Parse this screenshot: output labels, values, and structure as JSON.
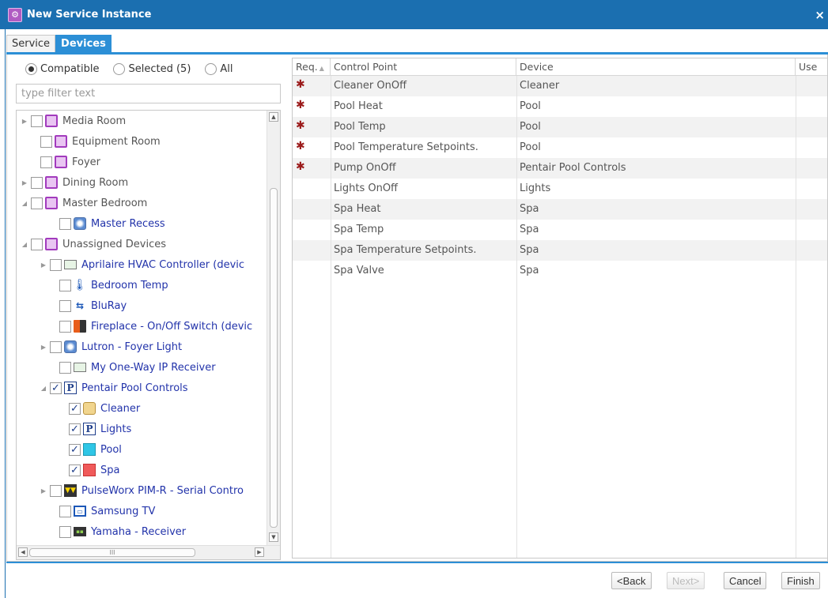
{
  "window": {
    "title": "New Service Instance",
    "close_glyph": "×",
    "icon": "gear-app-icon"
  },
  "tabs": [
    {
      "label": "Service",
      "active": false
    },
    {
      "label": "Devices",
      "active": true
    }
  ],
  "filter": {
    "options": [
      {
        "label": "Compatible",
        "selected": true
      },
      {
        "label": "Selected (5)",
        "selected": false
      },
      {
        "label": "All",
        "selected": false
      }
    ],
    "placeholder": "type filter text"
  },
  "tree": [
    {
      "label": "Media Room",
      "icon": "room-icon",
      "toggle": "collapsed",
      "checked": false,
      "kind": "room"
    },
    {
      "label": "Equipment Room",
      "icon": "room-icon",
      "toggle": "",
      "checked": false,
      "kind": "room"
    },
    {
      "label": "Foyer",
      "icon": "room-icon",
      "toggle": "",
      "checked": false,
      "kind": "room"
    },
    {
      "label": "Dining Room",
      "icon": "room-icon",
      "toggle": "collapsed",
      "checked": false,
      "kind": "room"
    },
    {
      "label": "Master Bedroom",
      "icon": "room-icon",
      "toggle": "expanded",
      "checked": false,
      "kind": "room"
    },
    {
      "label": "Master Recess",
      "icon": "light-icon",
      "toggle": "",
      "checked": false,
      "kind": "device"
    },
    {
      "label": "Unassigned Devices",
      "icon": "room-icon",
      "toggle": "expanded",
      "checked": false,
      "kind": "room"
    },
    {
      "label": "Aprilaire HVAC Controller (devic",
      "icon": "hvac-icon",
      "toggle": "collapsed",
      "checked": false,
      "kind": "device"
    },
    {
      "label": "Bedroom Temp",
      "icon": "thermometer-icon",
      "toggle": "",
      "checked": false,
      "kind": "device"
    },
    {
      "label": "BluRay",
      "icon": "bluray-icon",
      "toggle": "",
      "checked": false,
      "kind": "device"
    },
    {
      "label": "Fireplace - On/Off Switch (devic",
      "icon": "fireplace-icon",
      "toggle": "",
      "checked": false,
      "kind": "device"
    },
    {
      "label": "Lutron - Foyer Light",
      "icon": "light-icon",
      "toggle": "collapsed",
      "checked": false,
      "kind": "device"
    },
    {
      "label": "My One-Way IP Receiver",
      "icon": "receiver-icon",
      "toggle": "",
      "checked": false,
      "kind": "device"
    },
    {
      "label": "Pentair Pool Controls",
      "icon": "pentair-icon",
      "toggle": "expanded",
      "checked": true,
      "kind": "device"
    },
    {
      "label": "Cleaner",
      "icon": "cleaner-icon",
      "toggle": "",
      "checked": true,
      "kind": "device"
    },
    {
      "label": "Lights",
      "icon": "pentair-icon",
      "toggle": "",
      "checked": true,
      "kind": "device"
    },
    {
      "label": "Pool",
      "icon": "pool-icon",
      "toggle": "",
      "checked": true,
      "kind": "device"
    },
    {
      "label": "Spa",
      "icon": "spa-icon",
      "toggle": "",
      "checked": true,
      "kind": "device"
    },
    {
      "label": "PulseWorx PIM-R - Serial Contro",
      "icon": "pim-icon",
      "toggle": "collapsed",
      "checked": false,
      "kind": "device"
    },
    {
      "label": "Samsung TV",
      "icon": "tv-icon",
      "toggle": "",
      "checked": false,
      "kind": "device"
    },
    {
      "label": "Yamaha - Receiver",
      "icon": "av-receiver-icon",
      "toggle": "",
      "checked": false,
      "kind": "device"
    }
  ],
  "hscroll_glyph": "III",
  "grid": {
    "columns": [
      "Req.",
      "Control Point",
      "Device",
      "Use"
    ],
    "rows": [
      {
        "required": true,
        "control_point": "Cleaner OnOff",
        "device": "Cleaner"
      },
      {
        "required": true,
        "control_point": "Pool Heat",
        "device": "Pool"
      },
      {
        "required": true,
        "control_point": "Pool Temp",
        "device": "Pool"
      },
      {
        "required": true,
        "control_point": "Pool Temperature Setpoints.",
        "device": "Pool"
      },
      {
        "required": true,
        "control_point": "Pump OnOff",
        "device": "Pentair Pool Controls"
      },
      {
        "required": false,
        "control_point": "Lights OnOff",
        "device": "Lights"
      },
      {
        "required": false,
        "control_point": "Spa Heat",
        "device": "Spa"
      },
      {
        "required": false,
        "control_point": "Spa Temp",
        "device": "Spa"
      },
      {
        "required": false,
        "control_point": "Spa Temperature Setpoints.",
        "device": "Spa"
      },
      {
        "required": false,
        "control_point": "Spa Valve",
        "device": "Spa"
      }
    ],
    "required_mark": "✱"
  },
  "footer": {
    "back": "<Back",
    "next": "Next>",
    "cancel": "Cancel",
    "finish": "Finish"
  }
}
